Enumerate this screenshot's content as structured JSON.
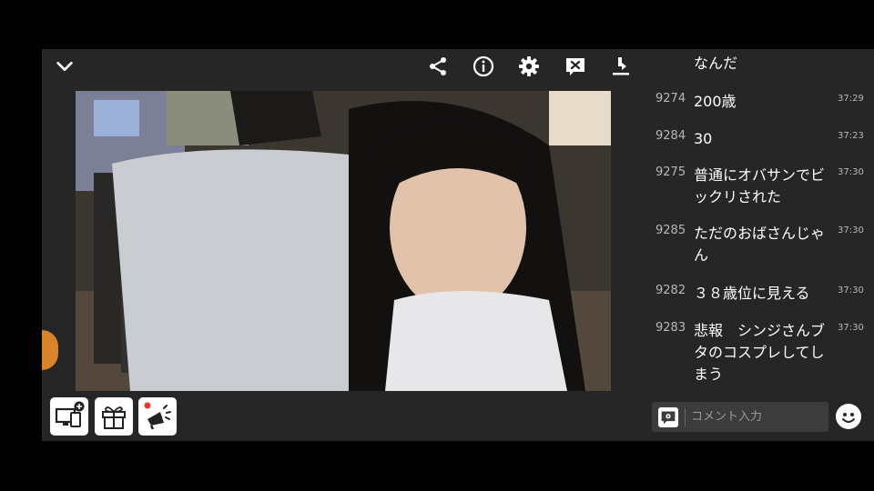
{
  "player": {
    "toolbar_icons": [
      "chevron-down-icon",
      "share-icon",
      "info-icon",
      "gear-icon",
      "close-chat-icon",
      "download-icon"
    ],
    "bottom_buttons": [
      "screen-add-icon",
      "gift-icon",
      "megaphone-icon"
    ]
  },
  "chat": {
    "messages": [
      {
        "num": "",
        "text": "なんだ",
        "time": ""
      },
      {
        "num": "9274",
        "text": "200歳",
        "time": "37:29"
      },
      {
        "num": "9284",
        "text": "30",
        "time": "37:23"
      },
      {
        "num": "9275",
        "text": "普通にオバサンでビックリされた",
        "time": "37:30"
      },
      {
        "num": "9285",
        "text": "ただのおばさんじゃん",
        "time": "37:30"
      },
      {
        "num": "9282",
        "text": "３８歳位に見える",
        "time": "37:30"
      },
      {
        "num": "9283",
        "text": "悲報　シンジさんブタのコスプレしてしまう",
        "time": "37:30"
      }
    ]
  },
  "comment": {
    "placeholder": "コメント入力"
  },
  "colors": {
    "panel": "#262626",
    "accent_orange": "#d9832a",
    "red_dot": "#e53935"
  }
}
